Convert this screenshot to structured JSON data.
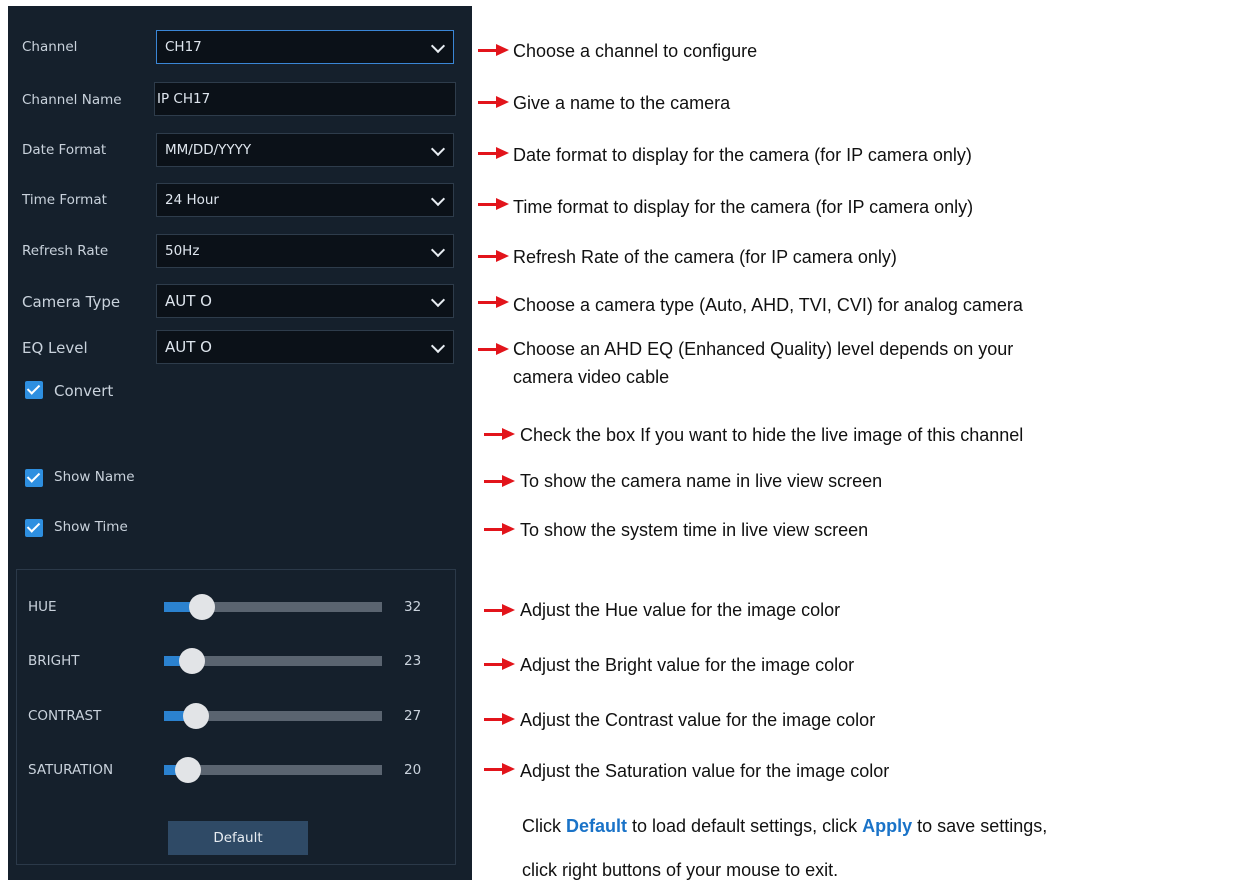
{
  "settings": {
    "channel": {
      "label": "Channel",
      "value": "CH17"
    },
    "channel_name": {
      "label": "Channel Name",
      "value": "IP CH17"
    },
    "date_format": {
      "label": "Date Format",
      "value": "MM/DD/YYYY"
    },
    "time_format": {
      "label": "Time Format",
      "value": "24 Hour"
    },
    "refresh_rate": {
      "label": "Refresh Rate",
      "value": "50Hz"
    },
    "camera_type": {
      "label": "Camera Type",
      "value": "AUT O"
    },
    "eq_level": {
      "label": "EQ Level",
      "value": "AUT O"
    },
    "convert": {
      "label": "Convert",
      "checked": true
    },
    "show_name": {
      "label": "Show Name",
      "checked": true
    },
    "show_time": {
      "label": "Show Time",
      "checked": true
    }
  },
  "image": {
    "hue": {
      "label": "HUE",
      "value": "32",
      "level": 0.32
    },
    "bright": {
      "label": "BRIGHT",
      "value": "23",
      "level": 0.23
    },
    "contrast": {
      "label": "CONTRAST",
      "value": "27",
      "level": 0.27
    },
    "saturation": {
      "label": "SATURATION",
      "value": "20",
      "level": 0.2
    },
    "default_button": "Default"
  },
  "annotations": {
    "channel": "Choose a channel to configure",
    "channel_name": "Give a name to the camera",
    "date_format": "Date format to display for the camera (for IP camera only)",
    "time_format": "Time format to display for the camera (for IP camera only)",
    "refresh_rate": "Refresh Rate of the camera (for IP camera only)",
    "camera_type": "Choose a camera type (Auto, AHD, TVI, CVI) for analog camera",
    "eq_level_1": "Choose an AHD EQ (Enhanced Quality) level depends on your",
    "eq_level_2": "camera video cable",
    "covert": "Check the box If you want to hide the live image of this channel",
    "show_name": "To show the camera name in live view screen",
    "show_time": "To show the system time in live view screen",
    "hue": "Adjust the Hue value for the image color",
    "bright": "Adjust the Bright value for the image color",
    "contrast": "Adjust the Contrast value for the image color",
    "saturation": "Adjust the Saturation value for the image color"
  },
  "footer": {
    "click1": "Click ",
    "default_kw": "Default",
    "mid": " to load default settings, click ",
    "apply_kw": "Apply",
    "end": " to save settings,",
    "line2": "click right buttons of your mouse to exit."
  },
  "colors": {
    "panel_bg": "#15202c",
    "accent": "#2e8fe0",
    "arrow": "#e2141b",
    "keyword": "#1a73c8"
  },
  "icons": [
    "chevron-down-icon",
    "checkbox-checked-icon",
    "red-arrow-icon"
  ]
}
